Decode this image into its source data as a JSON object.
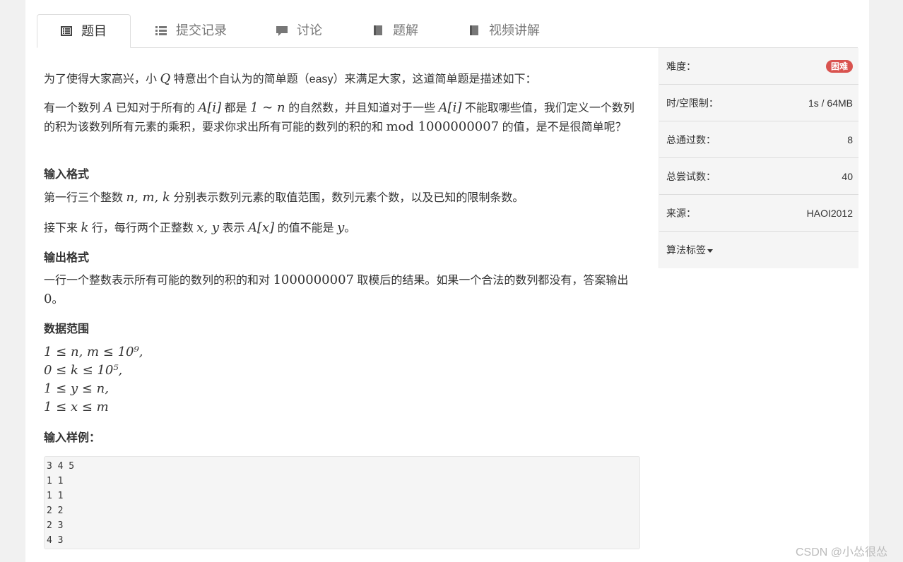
{
  "tabs": [
    {
      "label": "题目",
      "icon": "list-alt-icon",
      "active": true
    },
    {
      "label": "提交记录",
      "icon": "list-icon"
    },
    {
      "label": "讨论",
      "icon": "comment-icon"
    },
    {
      "label": "题解",
      "icon": "book-icon"
    },
    {
      "label": "视频讲解",
      "icon": "book-icon"
    }
  ],
  "problem": {
    "intro_a": "为了使得大家高兴，小 ",
    "intro_q": "Q",
    "intro_b": " 特意出个自认为的简单题（easy）来满足大家，这道简单题是描述如下：",
    "desc_1": "有一个数列 ",
    "desc_A": "A",
    "desc_2": " 已知对于所有的 ",
    "desc_Ai": "A[i]",
    "desc_3": " 都是 ",
    "desc_range": "1 ∼ n",
    "desc_4": " 的自然数，并且知道对于一些 ",
    "desc_Ai2": "A[i]",
    "desc_5": " 不能取哪些值，我们定义一个数列的积为该数列所有元素的乘积，要求你求出所有可能的数列的积的和 ",
    "desc_mod": "mod 1000000007",
    "desc_6": " 的值，是不是很简单呢？",
    "input_title": "输入格式",
    "input_1a": "第一行三个整数 ",
    "input_1m": "n, m, k",
    "input_1b": " 分别表示数列元素的取值范围，数列元素个数，以及已知的限制条数。",
    "input_2a": "接下来 ",
    "input_2k": "k",
    "input_2b": " 行，每行两个正整数 ",
    "input_2xy": "x, y",
    "input_2c": " 表示 ",
    "input_2Ax": "A[x]",
    "input_2d": " 的值不能是 ",
    "input_2y": "y",
    "input_2e": "。",
    "output_title": "输出格式",
    "output_a": "一行一个整数表示所有可能的数列的积的和对 ",
    "output_num": "1000000007",
    "output_b": " 取模后的结果。如果一个合法的数列都没有，答案输出 ",
    "output_zero": "0",
    "output_c": "。",
    "range_title": "数据范围",
    "range_1": "1 ≤ n, m ≤ 10⁹,",
    "range_2": "0 ≤ k ≤ 10⁵,",
    "range_3": "1 ≤ y ≤ n,",
    "range_4": "1 ≤ x ≤ m",
    "sample_title": "输入样例：",
    "sample_input": "3 4 5\n1 1\n1 1\n2 2\n2 3\n4 3"
  },
  "sidebar": {
    "difficulty_label": "难度：",
    "difficulty_value": "困难",
    "difficulty_color": "#d9534f",
    "limit_label": "时/空限制：",
    "limit_value": "1s / 64MB",
    "passed_label": "总通过数：",
    "passed_value": "8",
    "tried_label": "总尝试数：",
    "tried_value": "40",
    "source_label": "来源：",
    "source_value": "HAOI2012",
    "tags_label": "算法标签"
  },
  "watermark": "CSDN @小怂很怂"
}
